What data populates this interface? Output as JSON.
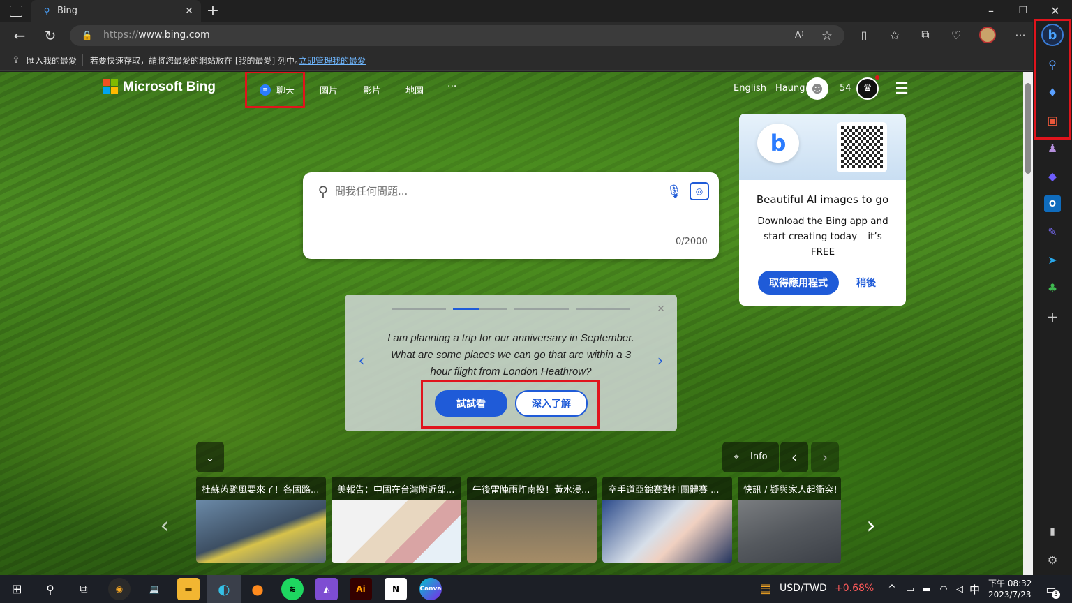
{
  "browser": {
    "tab_title": "Bing",
    "url_prefix": "https://",
    "url_domain": "www.bing.com",
    "favorites_import": "匯入我的最愛",
    "favorites_hint": "若要快速存取，請將您最愛的網站放在 [我的最愛] 列中。",
    "favorites_link": "立即管理我的最愛"
  },
  "bing": {
    "logo": "Microsoft Bing",
    "nav": [
      "聊天",
      "圖片",
      "影片",
      "地圖",
      "···"
    ],
    "language": "English",
    "user": "Haung",
    "points": "54",
    "search_placeholder": "問我任何問題...",
    "char_count": "0/2000"
  },
  "promo": {
    "title": "Beautiful AI images to go",
    "body": "Download the Bing app and start creating today – it’s FREE",
    "get_app": "取得應用程式",
    "later": "稍後"
  },
  "prompt": {
    "text": "I am planning a trip for our anniversary in September. What are some places we can go that are within a 3 hour flight from London Heathrow?",
    "try": "試試看",
    "learn": "深入了解",
    "active_step": 2,
    "total_steps": 4
  },
  "info_label": "Info",
  "news": [
    {
      "title": "杜蘇芮颱風要來了！各國路..."
    },
    {
      "title": "美報告：中國在台灣附近部..."
    },
    {
      "title": "午後雷陣雨炸南投！黃水漫..."
    },
    {
      "title": "空手道亞錦賽對打團體賽 ..."
    },
    {
      "title": "快訊 / 疑與家人起衝突!"
    }
  ],
  "taskbar": {
    "currency": "USD/TWD",
    "change": "+0.68%",
    "ime": "中",
    "time": "下午 08:32",
    "date": "2023/7/23",
    "notifications": "3"
  },
  "colors": {
    "accent": "#1f5bd8",
    "up": "#ff5a5a",
    "highlight": "#e0141c"
  }
}
